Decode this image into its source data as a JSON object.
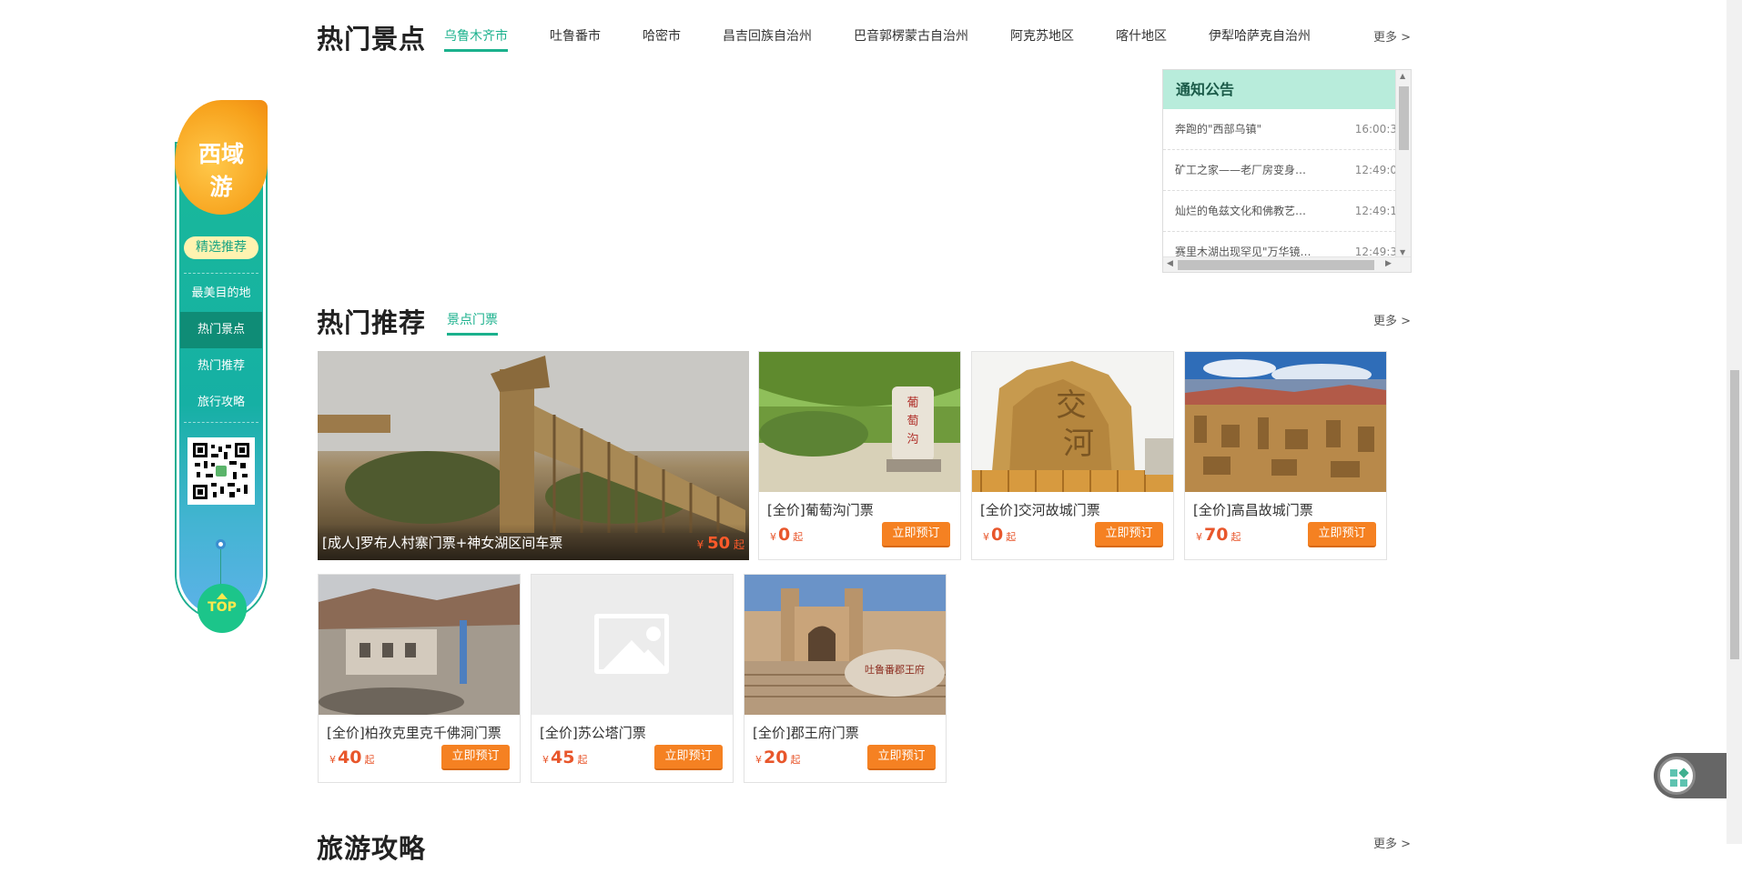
{
  "hot_spots": {
    "title": "热门景点",
    "tabs": [
      "乌鲁木齐市",
      "吐鲁番市",
      "哈密市",
      "昌吉回族自治州",
      "巴音郭楞蒙古自治州",
      "阿克苏地区",
      "喀什地区",
      "伊犁哈萨克自治州"
    ],
    "active_tab": 0,
    "more": "更多 >"
  },
  "notice": {
    "title": "通知公告",
    "items": [
      {
        "text": "奔跑的\"西部乌镇\"",
        "time": "16:00:3"
      },
      {
        "text": "矿工之家——老厂房变身…",
        "time": "12:49:0"
      },
      {
        "text": "灿烂的龟兹文化和佛教艺…",
        "time": "12:49:1"
      },
      {
        "text": "赛里木湖出现罕见\"万华镜…",
        "time": "12:49:3"
      }
    ]
  },
  "hot_recommend": {
    "title": "热门推荐",
    "tabs": [
      "景点门票"
    ],
    "more": "更多 >",
    "currency": "¥",
    "from": "起",
    "book_label": "立即预订",
    "featured": {
      "name": "[成人]罗布人村寨门票+神女湖区间车票",
      "price": "50"
    },
    "cards": [
      {
        "name": "[全价]葡萄沟门票",
        "price": "0",
        "image": "grape-valley-photo"
      },
      {
        "name": "[全价]交河故城门票",
        "price": "0",
        "image": "jiaohe-ruins-photo"
      },
      {
        "name": "[全价]高昌故城门票",
        "price": "70",
        "image": "gaochang-ruins-photo"
      },
      {
        "name": "[全价]柏孜克里克千佛洞门票",
        "price": "40",
        "image": "bezeklik-caves-photo"
      },
      {
        "name": "[全价]苏公塔门票",
        "price": "45",
        "image": "placeholder-image-icon"
      },
      {
        "name": "[全价]郡王府门票",
        "price": "20",
        "image": "prince-mansion-photo"
      }
    ]
  },
  "travel_guide": {
    "title": "旅游攻略",
    "more": "更多 >"
  },
  "float_nav": {
    "logo_line1": "西域",
    "logo_line2": "游",
    "pick": "精选推荐",
    "items": [
      "最美目的地",
      "热门景点",
      "热门推荐",
      "旅行攻略"
    ],
    "active_item": 1,
    "top": "TOP"
  },
  "colors": {
    "accent": "#1bb18d",
    "book": "#f58122",
    "price": "#e8562b",
    "notice_header": "#b8ecdb"
  }
}
